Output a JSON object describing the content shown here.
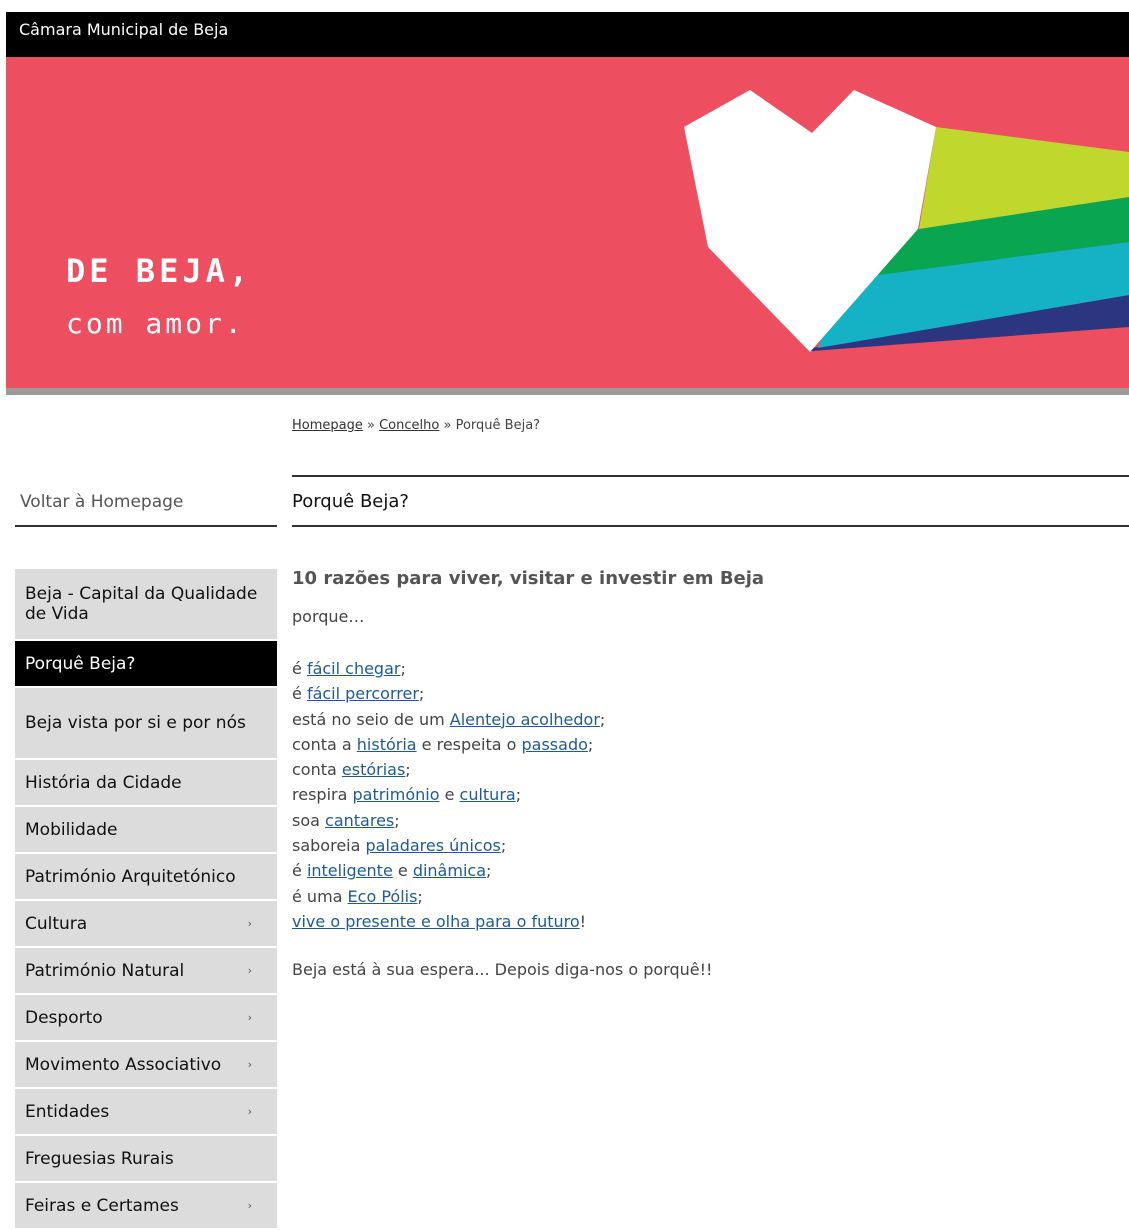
{
  "site_title": "Câmara Municipal de Beja",
  "banner": {
    "slogan_line1": "DE BEJA,",
    "slogan_line2": "com amor.",
    "colors": {
      "background": "#ed4f61",
      "heart": "#ffffff",
      "stripe_lime": "#c0d72e",
      "stripe_green": "#0aa550",
      "stripe_cyan": "#15b1c4",
      "stripe_navy": "#2b3580"
    }
  },
  "breadcrumb": {
    "home": "Homepage",
    "sep1": "»",
    "section": "Concelho",
    "sep2": "»",
    "current": "Porquê Beja?"
  },
  "back_link": "Voltar à Homepage",
  "page_title": "Porquê Beja?",
  "side_menu": [
    {
      "label": "Beja - Capital da Qualidade de Vida",
      "active": false,
      "arrow": ""
    },
    {
      "label": "Porquê Beja?",
      "active": true,
      "arrow": ""
    },
    {
      "label": "Beja vista por si e por nós",
      "active": false,
      "arrow": ""
    },
    {
      "label": "História da Cidade",
      "active": false,
      "arrow": ""
    },
    {
      "label": "Mobilidade",
      "active": false,
      "arrow": ""
    },
    {
      "label": "Património Arquitetónico",
      "active": false,
      "arrow": ""
    },
    {
      "label": "Cultura",
      "active": false,
      "arrow": "›"
    },
    {
      "label": "Património Natural",
      "active": false,
      "arrow": "›"
    },
    {
      "label": "Desporto",
      "active": false,
      "arrow": "›"
    },
    {
      "label": "Movimento Associativo",
      "active": false,
      "arrow": "›"
    },
    {
      "label": "Entidades",
      "active": false,
      "arrow": "›"
    },
    {
      "label": "Freguesias Rurais",
      "active": false,
      "arrow": ""
    },
    {
      "label": "Feiras e Certames",
      "active": false,
      "arrow": "›"
    }
  ],
  "content": {
    "heading": "10 razões para viver, visitar e investir em Beja",
    "intro": "porque…",
    "reasons": [
      {
        "parts": [
          {
            "t": "é "
          },
          {
            "t": "fácil chegar",
            "link": true
          },
          {
            "t": ";"
          }
        ]
      },
      {
        "parts": [
          {
            "t": "é "
          },
          {
            "t": "fácil percorrer",
            "link": true
          },
          {
            "t": ";"
          }
        ]
      },
      {
        "parts": [
          {
            "t": "está no seio de um "
          },
          {
            "t": "Alentejo acolhedor",
            "link": true
          },
          {
            "t": ";"
          }
        ]
      },
      {
        "parts": [
          {
            "t": "conta a "
          },
          {
            "t": "história",
            "link": true
          },
          {
            "t": " e respeita o "
          },
          {
            "t": "passado",
            "link": true
          },
          {
            "t": ";"
          }
        ]
      },
      {
        "parts": [
          {
            "t": "conta "
          },
          {
            "t": "estórias",
            "link": true
          },
          {
            "t": ";"
          }
        ]
      },
      {
        "parts": [
          {
            "t": "respira "
          },
          {
            "t": "património",
            "link": true
          },
          {
            "t": " e "
          },
          {
            "t": "cultura",
            "link": true
          },
          {
            "t": ";"
          }
        ]
      },
      {
        "parts": [
          {
            "t": "soa "
          },
          {
            "t": "cantares",
            "link": true
          },
          {
            "t": ";"
          }
        ]
      },
      {
        "parts": [
          {
            "t": "saboreia "
          },
          {
            "t": "paladares únicos",
            "link": true
          },
          {
            "t": ";"
          }
        ]
      },
      {
        "parts": [
          {
            "t": "é "
          },
          {
            "t": "inteligente",
            "link": true
          },
          {
            "t": " e "
          },
          {
            "t": "dinâmica",
            "link": true
          },
          {
            "t": ";"
          }
        ]
      },
      {
        "parts": [
          {
            "t": "é uma "
          },
          {
            "t": "Eco Pólis",
            "link": true
          },
          {
            "t": ";"
          }
        ]
      },
      {
        "parts": [
          {
            "t": "vive o presente e olha para o futuro",
            "link": true
          },
          {
            "t": "!"
          }
        ]
      }
    ],
    "closing": "Beja está à sua espera... Depois diga-nos o porquê!!"
  }
}
